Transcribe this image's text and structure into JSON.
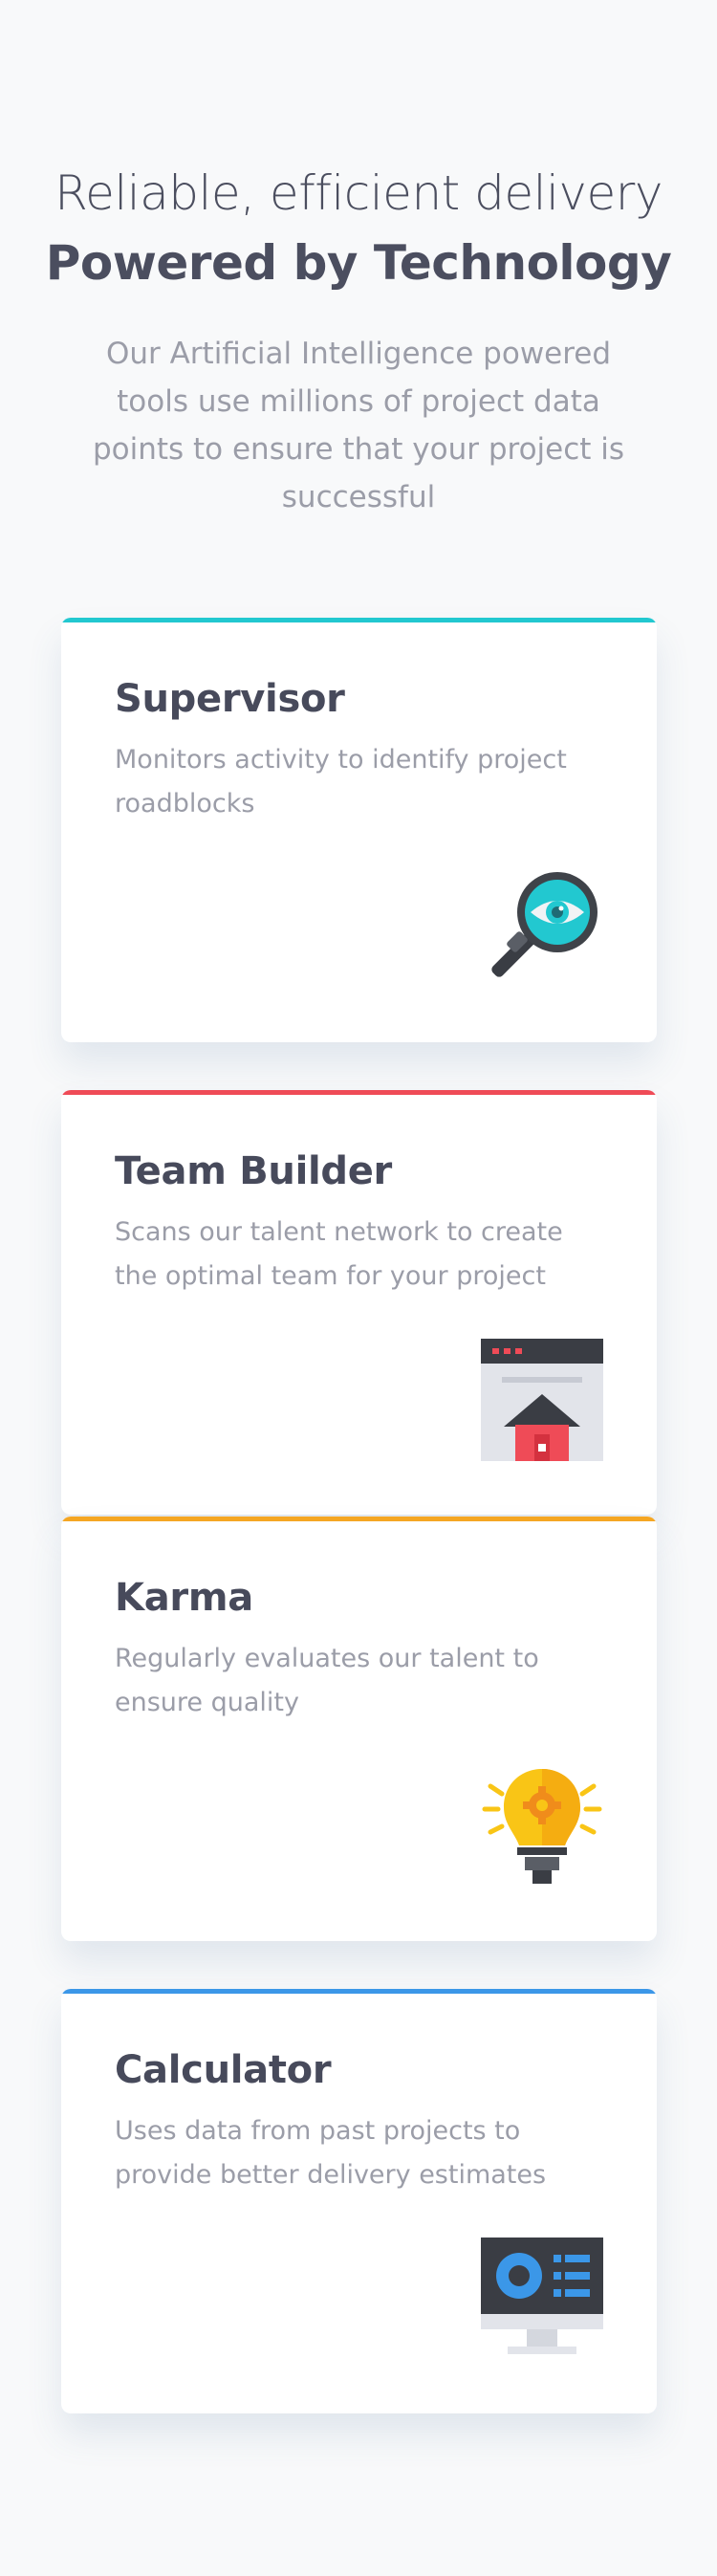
{
  "hero": {
    "line1": "Reliable, efficient delivery",
    "line2": "Powered by Technology",
    "subtitle": "Our Artificial Intelligence powered tools use millions of project data points to ensure that your project is successful"
  },
  "cards": [
    {
      "title": "Supervisor",
      "description": "Monitors activity to identify project roadblocks",
      "accent": "#22c8d0",
      "icon": "magnifier-eye-icon"
    },
    {
      "title": "Team Builder",
      "description": "Scans our talent network to create the optimal team for your project",
      "accent": "#ef4b57",
      "icon": "browser-house-icon"
    },
    {
      "title": "Karma",
      "description": "Regularly evaluates our talent to ensure quality",
      "accent": "#f5a623",
      "icon": "lightbulb-gear-icon"
    },
    {
      "title": "Calculator",
      "description": "Uses data from past projects to provide better delivery estimates",
      "accent": "#3b97e8",
      "icon": "monitor-chart-icon"
    }
  ]
}
